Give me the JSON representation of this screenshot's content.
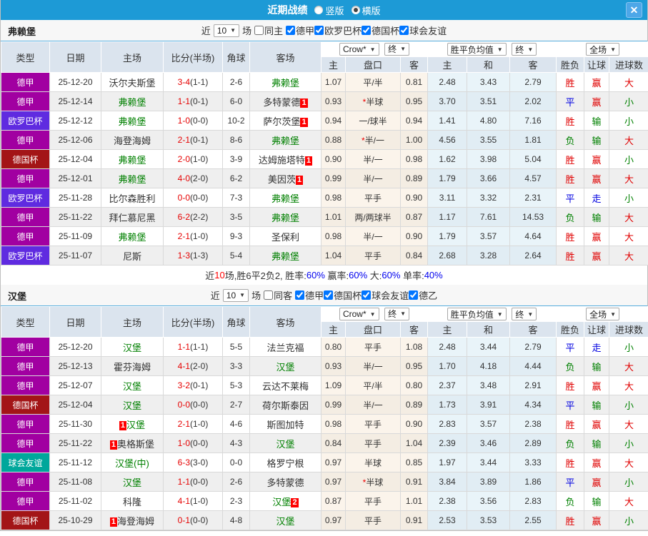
{
  "titlebar": {
    "title": "近期战绩",
    "vertical_label": "竖版",
    "horizontal_label": "横版",
    "close_glyph": "✕"
  },
  "table_header": {
    "type": "类型",
    "date": "日期",
    "home": "主场",
    "score": "比分(半场)",
    "corner": "角球",
    "away": "客场",
    "crow": "Crow*",
    "final1": "终",
    "avg": "胜平负均值",
    "final2": "终",
    "full": "全场",
    "h_home": "主",
    "h_handicap": "盘口",
    "h_away": "客",
    "a_home": "主",
    "a_draw": "和",
    "a_away": "客",
    "r_result": "胜负",
    "r_let": "让球",
    "r_goal": "进球数"
  },
  "type_colors": {
    "德甲": "#A100A1",
    "欧罗巴杯": "#5F2BE0",
    "德国杯": "#A31517",
    "球会友谊": "#00A79B"
  },
  "result_colors": {
    "胜": "#E00000",
    "平": "#0000E0",
    "负": "#008000",
    "赢": "#E00000",
    "走": "#0000E0",
    "输": "#008000",
    "大": "#E00000",
    "小": "#008000"
  },
  "sections": [
    {
      "team": "弗赖堡",
      "filter": {
        "near": "近",
        "count": "10",
        "unit": "场",
        "same": "同主",
        "same_checked": false,
        "leagues": [
          "德甲",
          "欧罗巴杯",
          "德国杯",
          "球会友谊"
        ]
      },
      "rows": [
        {
          "type": "德甲",
          "date": "25-12-20",
          "home": {
            "name": "沃尔夫斯堡",
            "green": false
          },
          "score": "3-4",
          "half": "(1-1)",
          "corner": "2-6",
          "away": {
            "name": "弗赖堡",
            "green": true
          },
          "o1": "1.07",
          "hstar": "",
          "hcap": "平/半",
          "o2": "0.81",
          "m1": "2.48",
          "m2": "3.43",
          "m3": "2.79",
          "r1": "胜",
          "r2": "赢",
          "r3": "大"
        },
        {
          "type": "德甲",
          "date": "25-12-14",
          "home": {
            "name": "弗赖堡",
            "green": true
          },
          "score": "1-1",
          "half": "(0-1)",
          "corner": "6-0",
          "away": {
            "name": "多特蒙德",
            "green": false,
            "badge": {
              "num": "1",
              "pos": "post"
            }
          },
          "o1": "0.93",
          "hstar": "*",
          "hcap": "半球",
          "o2": "0.95",
          "m1": "3.70",
          "m2": "3.51",
          "m3": "2.02",
          "r1": "平",
          "r2": "赢",
          "r3": "小"
        },
        {
          "type": "欧罗巴杯",
          "date": "25-12-12",
          "home": {
            "name": "弗赖堡",
            "green": true
          },
          "score": "1-0",
          "half": "(0-0)",
          "corner": "10-2",
          "away": {
            "name": "萨尔茨堡",
            "green": false,
            "badge": {
              "num": "1",
              "pos": "post"
            }
          },
          "o1": "0.94",
          "hstar": "",
          "hcap": "一/球半",
          "o2": "0.94",
          "m1": "1.41",
          "m2": "4.80",
          "m3": "7.16",
          "r1": "胜",
          "r2": "输",
          "r3": "小"
        },
        {
          "type": "德甲",
          "date": "25-12-06",
          "home": {
            "name": "海登海姆",
            "green": false
          },
          "score": "2-1",
          "half": "(0-1)",
          "corner": "8-6",
          "away": {
            "name": "弗赖堡",
            "green": true
          },
          "o1": "0.88",
          "hstar": "*",
          "hcap": "半/一",
          "o2": "1.00",
          "m1": "4.56",
          "m2": "3.55",
          "m3": "1.81",
          "r1": "负",
          "r2": "输",
          "r3": "大"
        },
        {
          "type": "德国杯",
          "date": "25-12-04",
          "home": {
            "name": "弗赖堡",
            "green": true
          },
          "score": "2-0",
          "half": "(1-0)",
          "corner": "3-9",
          "away": {
            "name": "达姆施塔特",
            "green": false,
            "badge": {
              "num": "1",
              "pos": "post"
            }
          },
          "o1": "0.90",
          "hstar": "",
          "hcap": "半/一",
          "o2": "0.98",
          "m1": "1.62",
          "m2": "3.98",
          "m3": "5.04",
          "r1": "胜",
          "r2": "赢",
          "r3": "小"
        },
        {
          "type": "德甲",
          "date": "25-12-01",
          "home": {
            "name": "弗赖堡",
            "green": true
          },
          "score": "4-0",
          "half": "(2-0)",
          "corner": "6-2",
          "away": {
            "name": "美因茨",
            "green": false,
            "badge": {
              "num": "1",
              "pos": "post"
            }
          },
          "o1": "0.99",
          "hstar": "",
          "hcap": "半/一",
          "o2": "0.89",
          "m1": "1.79",
          "m2": "3.66",
          "m3": "4.57",
          "r1": "胜",
          "r2": "赢",
          "r3": "大"
        },
        {
          "type": "欧罗巴杯",
          "date": "25-11-28",
          "home": {
            "name": "比尔森胜利",
            "green": false
          },
          "score": "0-0",
          "half": "(0-0)",
          "corner": "7-3",
          "away": {
            "name": "弗赖堡",
            "green": true
          },
          "o1": "0.98",
          "hstar": "",
          "hcap": "平手",
          "o2": "0.90",
          "m1": "3.11",
          "m2": "3.32",
          "m3": "2.31",
          "r1": "平",
          "r2": "走",
          "r3": "小"
        },
        {
          "type": "德甲",
          "date": "25-11-22",
          "home": {
            "name": "拜仁慕尼黑",
            "green": false
          },
          "score": "6-2",
          "half": "(2-2)",
          "corner": "3-5",
          "away": {
            "name": "弗赖堡",
            "green": true
          },
          "o1": "1.01",
          "hstar": "",
          "hcap": "两/两球半",
          "o2": "0.87",
          "m1": "1.17",
          "m2": "7.61",
          "m3": "14.53",
          "r1": "负",
          "r2": "输",
          "r3": "大"
        },
        {
          "type": "德甲",
          "date": "25-11-09",
          "home": {
            "name": "弗赖堡",
            "green": true
          },
          "score": "2-1",
          "half": "(1-0)",
          "corner": "9-3",
          "away": {
            "name": "圣保利",
            "green": false
          },
          "o1": "0.98",
          "hstar": "",
          "hcap": "半/一",
          "o2": "0.90",
          "m1": "1.79",
          "m2": "3.57",
          "m3": "4.64",
          "r1": "胜",
          "r2": "赢",
          "r3": "大"
        },
        {
          "type": "欧罗巴杯",
          "date": "25-11-07",
          "home": {
            "name": "尼斯",
            "green": false
          },
          "score": "1-3",
          "half": "(1-3)",
          "corner": "5-4",
          "away": {
            "name": "弗赖堡",
            "green": true
          },
          "o1": "1.04",
          "hstar": "",
          "hcap": "平手",
          "o2": "0.84",
          "m1": "2.68",
          "m2": "3.28",
          "m3": "2.64",
          "r1": "胜",
          "r2": "赢",
          "r3": "大"
        }
      ],
      "summary": [
        {
          "text": "近",
          "color": "#333333"
        },
        {
          "text": "10",
          "color": "#FF0000"
        },
        {
          "text": "场,胜6平2负2, 胜率:",
          "color": "#333333"
        },
        {
          "text": "60%",
          "color": "#0000EE"
        },
        {
          "text": " 赢率:",
          "color": "#333333"
        },
        {
          "text": "60%",
          "color": "#0000EE"
        },
        {
          "text": " 大:",
          "color": "#333333"
        },
        {
          "text": "60%",
          "color": "#0000EE"
        },
        {
          "text": " 单率:",
          "color": "#333333"
        },
        {
          "text": "40%",
          "color": "#0000EE"
        }
      ]
    },
    {
      "team": "汉堡",
      "filter": {
        "near": "近",
        "count": "10",
        "unit": "场",
        "same": "同客",
        "same_checked": false,
        "leagues": [
          "德甲",
          "德国杯",
          "球会友谊",
          "德乙"
        ]
      },
      "rows": [
        {
          "type": "德甲",
          "date": "25-12-20",
          "home": {
            "name": "汉堡",
            "green": true
          },
          "score": "1-1",
          "half": "(1-1)",
          "corner": "5-5",
          "away": {
            "name": "法兰克福",
            "green": false
          },
          "o1": "0.80",
          "hstar": "",
          "hcap": "平手",
          "o2": "1.08",
          "m1": "2.48",
          "m2": "3.44",
          "m3": "2.79",
          "r1": "平",
          "r2": "走",
          "r3": "小"
        },
        {
          "type": "德甲",
          "date": "25-12-13",
          "home": {
            "name": "霍芬海姆",
            "green": false
          },
          "score": "4-1",
          "half": "(2-0)",
          "corner": "3-3",
          "away": {
            "name": "汉堡",
            "green": true
          },
          "o1": "0.93",
          "hstar": "",
          "hcap": "半/一",
          "o2": "0.95",
          "m1": "1.70",
          "m2": "4.18",
          "m3": "4.44",
          "r1": "负",
          "r2": "输",
          "r3": "大"
        },
        {
          "type": "德甲",
          "date": "25-12-07",
          "home": {
            "name": "汉堡",
            "green": true
          },
          "score": "3-2",
          "half": "(0-1)",
          "corner": "5-3",
          "away": {
            "name": "云达不莱梅",
            "green": false
          },
          "o1": "1.09",
          "hstar": "",
          "hcap": "平/半",
          "o2": "0.80",
          "m1": "2.37",
          "m2": "3.48",
          "m3": "2.91",
          "r1": "胜",
          "r2": "赢",
          "r3": "大"
        },
        {
          "type": "德国杯",
          "date": "25-12-04",
          "home": {
            "name": "汉堡",
            "green": true
          },
          "score": "0-0",
          "half": "(0-0)",
          "corner": "2-7",
          "away": {
            "name": "荷尔斯泰因",
            "green": false
          },
          "o1": "0.99",
          "hstar": "",
          "hcap": "半/一",
          "o2": "0.89",
          "m1": "1.73",
          "m2": "3.91",
          "m3": "4.34",
          "r1": "平",
          "r2": "输",
          "r3": "小"
        },
        {
          "type": "德甲",
          "date": "25-11-30",
          "home": {
            "name": "汉堡",
            "green": true,
            "badge": {
              "num": "1",
              "pos": "pre"
            }
          },
          "score": "2-1",
          "half": "(1-0)",
          "corner": "4-6",
          "away": {
            "name": "斯图加特",
            "green": false
          },
          "o1": "0.98",
          "hstar": "",
          "hcap": "平手",
          "o2": "0.90",
          "m1": "2.83",
          "m2": "3.57",
          "m3": "2.38",
          "r1": "胜",
          "r2": "赢",
          "r3": "大"
        },
        {
          "type": "德甲",
          "date": "25-11-22",
          "home": {
            "name": "奥格斯堡",
            "green": false,
            "badge": {
              "num": "1",
              "pos": "pre"
            }
          },
          "score": "1-0",
          "half": "(0-0)",
          "corner": "4-3",
          "away": {
            "name": "汉堡",
            "green": true
          },
          "o1": "0.84",
          "hstar": "",
          "hcap": "平手",
          "o2": "1.04",
          "m1": "2.39",
          "m2": "3.46",
          "m3": "2.89",
          "r1": "负",
          "r2": "输",
          "r3": "小"
        },
        {
          "type": "球会友谊",
          "date": "25-11-12",
          "home": {
            "name": "汉堡(中)",
            "green": true
          },
          "score": "6-3",
          "half": "(3-0)",
          "corner": "0-0",
          "away": {
            "name": "格罗宁根",
            "green": false
          },
          "o1": "0.97",
          "hstar": "",
          "hcap": "半球",
          "o2": "0.85",
          "m1": "1.97",
          "m2": "3.44",
          "m3": "3.33",
          "r1": "胜",
          "r2": "赢",
          "r3": "大"
        },
        {
          "type": "德甲",
          "date": "25-11-08",
          "home": {
            "name": "汉堡",
            "green": true
          },
          "score": "1-1",
          "half": "(0-0)",
          "corner": "2-6",
          "away": {
            "name": "多特蒙德",
            "green": false
          },
          "o1": "0.97",
          "hstar": "*",
          "hcap": "半球",
          "o2": "0.91",
          "m1": "3.84",
          "m2": "3.89",
          "m3": "1.86",
          "r1": "平",
          "r2": "赢",
          "r3": "小"
        },
        {
          "type": "德甲",
          "date": "25-11-02",
          "home": {
            "name": "科隆",
            "green": false
          },
          "score": "4-1",
          "half": "(1-0)",
          "corner": "2-3",
          "away": {
            "name": "汉堡",
            "green": true,
            "badge": {
              "num": "2",
              "pos": "post"
            }
          },
          "o1": "0.87",
          "hstar": "",
          "hcap": "平手",
          "o2": "1.01",
          "m1": "2.38",
          "m2": "3.56",
          "m3": "2.83",
          "r1": "负",
          "r2": "输",
          "r3": "大"
        },
        {
          "type": "德国杯",
          "date": "25-10-29",
          "home": {
            "name": "海登海姆",
            "green": false,
            "badge": {
              "num": "1",
              "pos": "pre"
            }
          },
          "score": "0-1",
          "half": "(0-0)",
          "corner": "4-8",
          "away": {
            "name": "汉堡",
            "green": true
          },
          "o1": "0.97",
          "hstar": "",
          "hcap": "平手",
          "o2": "0.91",
          "m1": "2.53",
          "m2": "3.53",
          "m3": "2.55",
          "r1": "胜",
          "r2": "赢",
          "r3": "小"
        }
      ]
    }
  ]
}
